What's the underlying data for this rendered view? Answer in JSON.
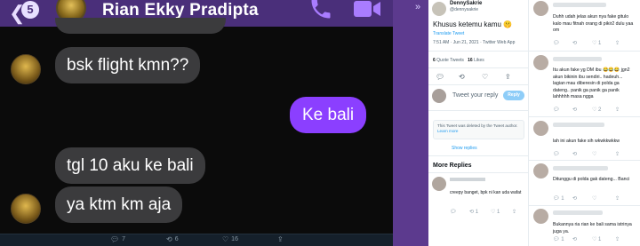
{
  "chat": {
    "back_glyph": "❮",
    "unread_count": "5",
    "contact_name": "Rian Ekky Pradipta",
    "messages": [
      {
        "from": "them",
        "text": "bsk flight kmn??"
      },
      {
        "from": "me",
        "text": "Ke bali"
      },
      {
        "from": "them",
        "text": "tgl 10 aku ke bali"
      },
      {
        "from": "them",
        "text": "ya ktm km aja"
      }
    ]
  },
  "tweet_bar": {
    "replies": "7",
    "retweets": "6",
    "likes": "16"
  },
  "sidebar": {
    "collapse_glyph": "»"
  },
  "tweet": {
    "author_name": "DennySakrie",
    "author_handle": "@dennysakrie",
    "text": "Khusus ketemu kamu 🤫",
    "translate_label": "Translate Tweet",
    "timestamp": "7:51 AM · Jun 21, 2021 · Twitter Web App",
    "quote_count": "6",
    "quote_label": "Quote Tweets",
    "likes_count": "16",
    "likes_label": "Likes",
    "reply_placeholder": "Tweet your reply",
    "reply_button": "Reply",
    "deleted_notice": "This Tweet was deleted by the Tweet author.",
    "learn_more": "Learn more",
    "show_replies": "Show replies",
    "more_replies_title": "More Replies",
    "more_reply_text": "creepy banget, bpk ni kan uda wafat",
    "more_reply_counts": {
      "retweets": "1",
      "likes": "1"
    }
  },
  "replies": [
    {
      "text": "Duhh udah jelas akun nya fake gitulo kalo mau fitnah orang di pikir2 dulu yaa om",
      "counts": {
        "likes": "1"
      }
    },
    {
      "text": "Itu akun fake yg DM ibu 😂😂😂 jgn2 akun bikinin ibu sendiri.. hadeuh... lagian mau diberesin di polda ga dateng.. panik ga panik ga panik lahhhhh masa ngga",
      "counts": {
        "likes": "2"
      }
    },
    {
      "text": "lah ini akun fake sih wkwkkwkkw",
      "counts": {}
    },
    {
      "text": "Ditunggu di polda gak dateng... Banci",
      "counts": {
        "replies": "1"
      }
    },
    {
      "text": "Bukannya ria rian ke bali sama istrinya juga ya.",
      "counts": {
        "replies": "1",
        "likes": "1"
      }
    }
  ]
}
